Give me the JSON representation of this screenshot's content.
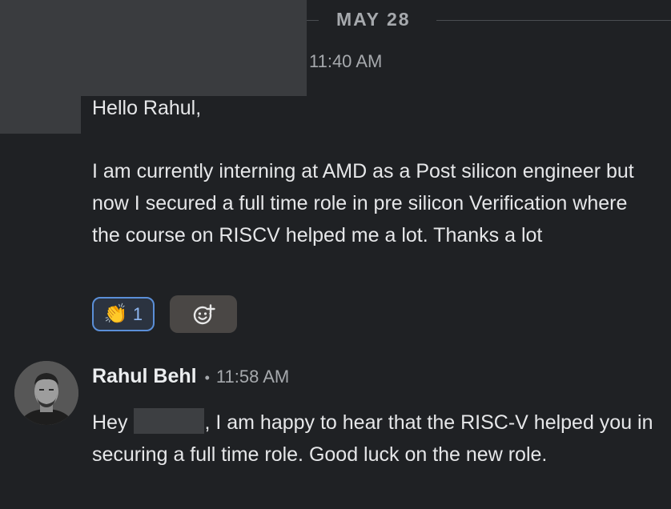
{
  "date_divider": {
    "label": "MAY 28"
  },
  "first_message": {
    "time": "11:40 AM",
    "greeting": "Hello Rahul,",
    "body": "I am currently interning at AMD as a Post silicon engineer but now I secured a full time role in pre silicon Verification where the course on RISCV helped me a lot. Thanks a lot",
    "reactions": [
      {
        "icon": "clapping-hands-icon",
        "emoji": "👏",
        "count": "1",
        "active": true
      }
    ],
    "add_reaction_icon": "add-emoji-icon"
  },
  "reply": {
    "author": "Rahul Behl",
    "separator": "•",
    "time": "11:58 AM",
    "text_before_redaction": "Hey",
    "text_after_redaction": ", I am happy to hear that the RISC-V helped you in securing a full time role. Good luck on the new role."
  },
  "colors": {
    "background": "#1f2124",
    "reaction_border": "#5b8fd8",
    "redaction": "#3a3c3f"
  }
}
